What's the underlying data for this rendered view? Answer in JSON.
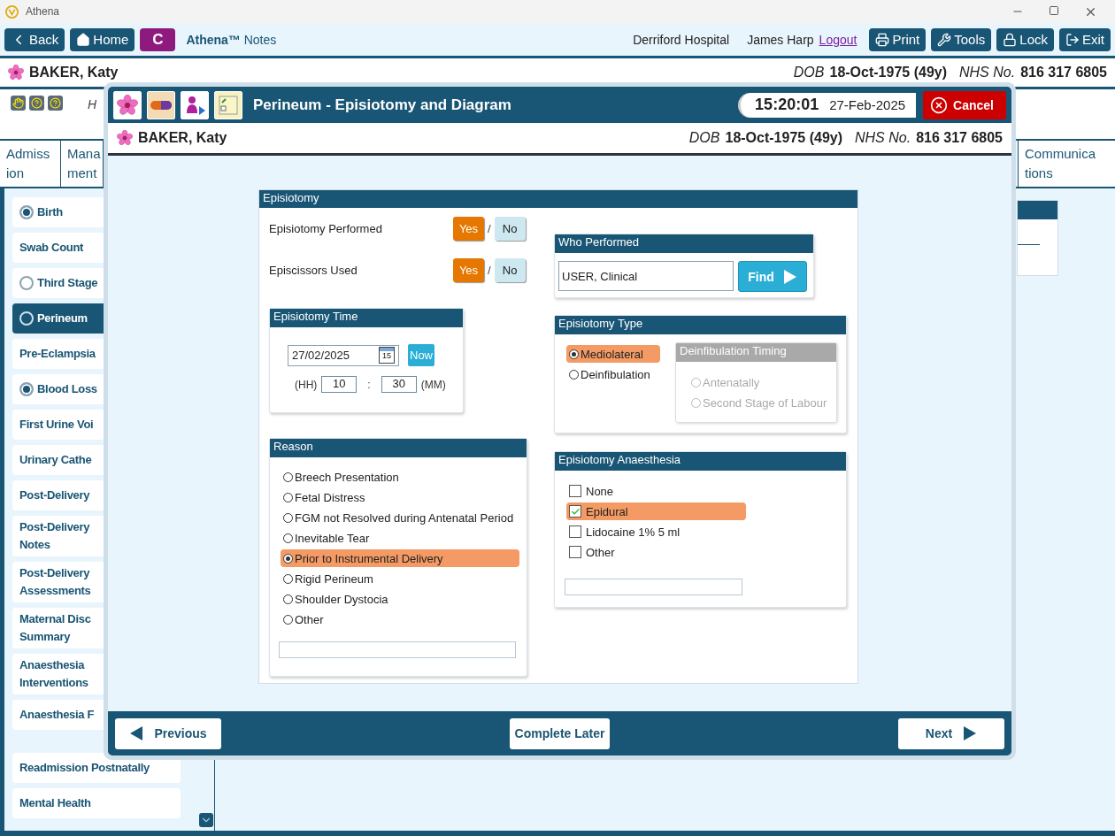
{
  "window": {
    "title": "Athena"
  },
  "toolbar": {
    "back": "Back",
    "home": "Home",
    "c_button": "C",
    "brand": "**Athena™** Notes",
    "hospital": "Derriford Hospital",
    "user": "James Harp",
    "logout": "Logout",
    "actions": [
      "Print",
      "Tools",
      "Lock",
      "Exit"
    ]
  },
  "patient": {
    "name": "BAKER, Katy",
    "dob_label": "DOB",
    "dob": "18-Oct-1975 (49y)",
    "nhs_label": "NHS No.",
    "nhs": "816 317 6805"
  },
  "banner_text": "H",
  "tabs": [
    {
      "label": "Admiss ion"
    },
    {
      "label": "Mana ment"
    },
    {
      "label": "Communica tions"
    }
  ],
  "sidebar": {
    "items": [
      {
        "label": "Birth",
        "kind": "radio",
        "checked": true,
        "selected": false
      },
      {
        "label": "Swab Count",
        "kind": "plain",
        "selected": false
      },
      {
        "label": "Third Stage",
        "kind": "radio",
        "checked": false,
        "selected": false
      },
      {
        "label": "Perineum",
        "kind": "radio",
        "checked": false,
        "selected": true
      },
      {
        "label": "Pre-Eclampsia",
        "kind": "plain",
        "selected": false
      },
      {
        "label": "Blood Loss",
        "kind": "radio",
        "checked": true,
        "selected": false
      },
      {
        "label": "First Urine Voi",
        "kind": "plain",
        "selected": false
      },
      {
        "label": "Urinary Cathe",
        "kind": "plain",
        "selected": false
      },
      {
        "label": "Post-Delivery",
        "kind": "plain",
        "selected": false
      },
      {
        "label": "Post-Delivery\nNotes",
        "kind": "plain",
        "selected": false
      },
      {
        "label": "Post-Delivery\nAssessments",
        "kind": "plain",
        "selected": false
      },
      {
        "label": "Maternal Disc\nSummary",
        "kind": "plain",
        "selected": false
      },
      {
        "label": "Anaesthesia\nInterventions",
        "kind": "plain",
        "selected": false
      },
      {
        "label": "Anaesthesia F",
        "kind": "plain",
        "selected": false
      },
      {
        "label": "Readmission Postnatally",
        "kind": "plain",
        "selected": false
      },
      {
        "label": "Mental Health",
        "kind": "plain",
        "selected": false
      }
    ]
  },
  "modal": {
    "title": "Perineum - Episiotomy and Diagram",
    "time": "15:20:01",
    "date": "27-Feb-2025",
    "cancel": "Cancel",
    "patient": {
      "name": "BAKER, Katy",
      "dob_label": "DOB",
      "dob": "18-Oct-1975 (49y)",
      "nhs_label": "NHS No.",
      "nhs": "816 317 6805"
    },
    "form": {
      "title": "Episiotomy",
      "questions": [
        {
          "label": "Episiotomy Performed",
          "separator": "/",
          "options": [
            {
              "label": "Yes",
              "selected": true
            },
            {
              "label": "No",
              "selected": false
            }
          ]
        },
        {
          "label": "Episcissors Used",
          "separator": "/",
          "options": [
            {
              "label": "Yes",
              "selected": true
            },
            {
              "label": "No",
              "selected": false
            }
          ]
        }
      ],
      "time": {
        "title": "Episiotomy Time",
        "date": "27/02/2025",
        "calendar_day": "15",
        "now": "Now",
        "hh_label": "(HH)",
        "hh": "10",
        "separator": ":",
        "mm": "30",
        "mm_label": "(MM)"
      },
      "reason": {
        "title": "Reason",
        "options": [
          {
            "label": "Breech Presentation",
            "selected": false
          },
          {
            "label": "Fetal Distress",
            "selected": false
          },
          {
            "label": "FGM not Resolved during Antenatal Period",
            "selected": false
          },
          {
            "label": "Inevitable Tear",
            "selected": false
          },
          {
            "label": "Prior to Instrumental Delivery",
            "selected": true
          },
          {
            "label": "Rigid Perineum",
            "selected": false
          },
          {
            "label": "Shoulder Dystocia",
            "selected": false
          },
          {
            "label": "Other",
            "selected": false
          }
        ]
      },
      "who": {
        "title": "Who Performed",
        "value": "USER, Clinical",
        "button": "Find"
      },
      "type": {
        "title": "Episiotomy Type",
        "options": [
          {
            "label": "Mediolateral",
            "selected": true
          },
          {
            "label": "Deinfibulation",
            "selected": false
          }
        ],
        "timing": {
          "title": "Deinfibulation Timing",
          "disabled": true,
          "options": [
            {
              "label": "Antenatally",
              "selected": false
            },
            {
              "label": "Second Stage of Labour",
              "selected": false
            }
          ]
        }
      },
      "anaesthesia": {
        "title": "Episiotomy Anaesthesia",
        "options": [
          {
            "label": "None",
            "checked": false
          },
          {
            "label": "Epidural",
            "checked": true
          },
          {
            "label": "Lidocaine 1% 5 ml",
            "checked": false
          },
          {
            "label": "Other",
            "checked": false
          }
        ]
      }
    },
    "footer": {
      "previous": "Previous",
      "later": "Complete Later",
      "next": "Next"
    }
  }
}
